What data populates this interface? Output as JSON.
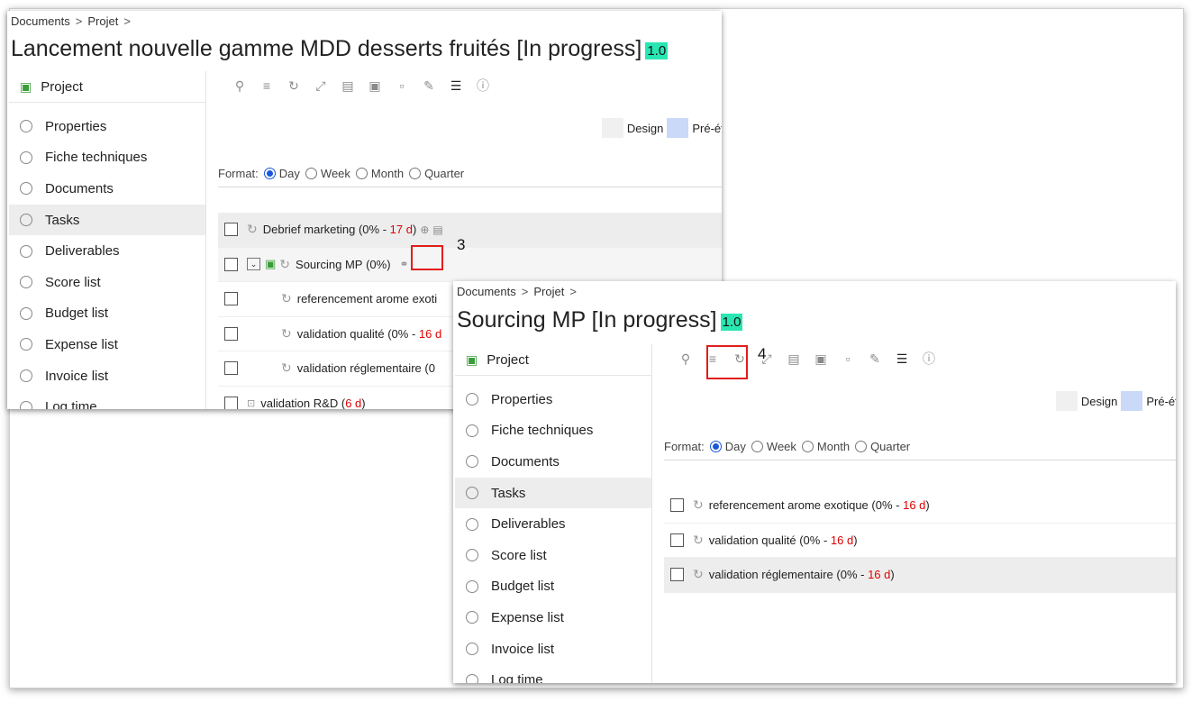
{
  "panel1": {
    "breadcrumb": [
      "Documents",
      "Projet"
    ],
    "title": "Lancement nouvelle gamme MDD desserts fruités [In progress]",
    "version": "1.0",
    "sidebar_head": "Project",
    "sidebar_items": [
      "Properties",
      "Fiche techniques",
      "Documents",
      "Tasks",
      "Deliverables",
      "Score list",
      "Budget list",
      "Expense list",
      "Invoice list",
      "Log time"
    ],
    "active_item": "Tasks",
    "legend": [
      "Design",
      "Pré-étu"
    ],
    "format_label": "Format:",
    "format_options": [
      "Day",
      "Week",
      "Month",
      "Quarter"
    ],
    "format_selected": "Day",
    "tasks": [
      {
        "name": "Debrief marketing",
        "pct": "(0% -",
        "dur": "17 d",
        "close": ")"
      },
      {
        "name": "Sourcing MP",
        "pct": "(0%)"
      },
      {
        "name": "referencement arome exoti"
      },
      {
        "name": "validation qualité",
        "pct": "(0% -",
        "dur": "16 d"
      },
      {
        "name": "validation réglementaire",
        "pct": "(0"
      },
      {
        "name": "validation R&D",
        "pct": "(",
        "dur": "6 d",
        "close": ")"
      }
    ],
    "callout": "3"
  },
  "panel2": {
    "breadcrumb": [
      "Documents",
      "Projet"
    ],
    "title": "Sourcing MP [In progress]",
    "version": "1.0",
    "sidebar_head": "Project",
    "sidebar_items": [
      "Properties",
      "Fiche techniques",
      "Documents",
      "Tasks",
      "Deliverables",
      "Score list",
      "Budget list",
      "Expense list",
      "Invoice list",
      "Log time"
    ],
    "active_item": "Tasks",
    "legend": [
      "Design",
      "Pré-étu"
    ],
    "format_label": "Format:",
    "format_options": [
      "Day",
      "Week",
      "Month",
      "Quarter"
    ],
    "format_selected": "Day",
    "tasks": [
      {
        "name": "referencement arome exotique",
        "pct": "(0% -",
        "dur": "16 d",
        "close": ")"
      },
      {
        "name": "validation qualité",
        "pct": "(0% -",
        "dur": "16 d",
        "close": ")"
      },
      {
        "name": "validation réglementaire",
        "pct": "(0% -",
        "dur": "16 d",
        "close": ")"
      }
    ],
    "callout": "4"
  },
  "colors": {
    "accent": "#1a56db",
    "version_bg": "#29e6b3",
    "highlight": "#e21d1d",
    "duration": "#e00000"
  }
}
